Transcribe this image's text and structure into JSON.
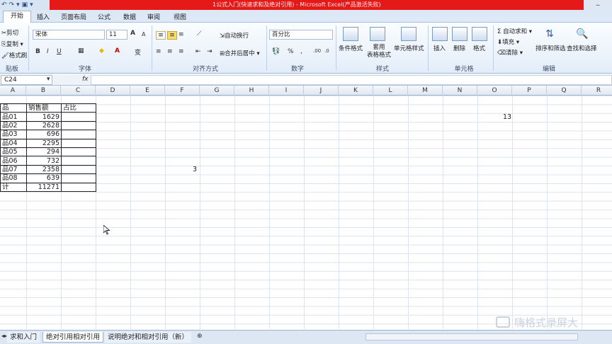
{
  "window": {
    "title": "1公式入门(快速求和及绝对引用) - Microsoft Excel(产品激活失败)"
  },
  "qat": [
    "↶",
    "↷",
    "▾",
    "▣",
    "▾"
  ],
  "tabs": [
    "开始",
    "插入",
    "页面布局",
    "公式",
    "数据",
    "审阅",
    "视图"
  ],
  "ribbon": {
    "clipboard": {
      "cut": "剪切",
      "copy": "复制 ▾",
      "format_painter": "格式刷",
      "label": "贴板"
    },
    "font": {
      "name": "宋体",
      "size": "11",
      "bold": "B",
      "italic": "I",
      "underline": "U",
      "grow": "A",
      "shrink": "A",
      "wen": "变",
      "label": "字体"
    },
    "align": {
      "wrap": "自动换行",
      "merge": "合并后居中 ▾",
      "label": "对齐方式"
    },
    "number": {
      "format": "百分比",
      "pct": "%",
      "comma": ",",
      "label": "数字"
    },
    "styles": {
      "cond": "条件格式",
      "table": "套用\n表格格式",
      "cell": "单元格样式",
      "label": "样式"
    },
    "cells": {
      "insert": "插入",
      "delete": "删除",
      "format": "格式",
      "label": "单元格"
    },
    "edit": {
      "autosum": "Σ 自动求和 ▾",
      "fill": "填充 ▾",
      "clear": "清除 ▾",
      "sort": "排序和筛选",
      "find": "查找和选择",
      "label": "编辑"
    }
  },
  "formula": {
    "namebox": "C24",
    "fx": "fx",
    "content": ""
  },
  "columns": [
    "A",
    "B",
    "C",
    "D",
    "E",
    "F",
    "G",
    "H",
    "I",
    "J",
    "K",
    "L",
    "M",
    "N",
    "O",
    "P",
    "Q",
    "R"
  ],
  "table": {
    "headers": [
      "品",
      "销售额",
      "占比"
    ],
    "rows": [
      [
        "品01",
        "1629",
        ""
      ],
      [
        "品02",
        "2628",
        ""
      ],
      [
        "品03",
        "696",
        ""
      ],
      [
        "品04",
        "2295",
        ""
      ],
      [
        "品05",
        "294",
        ""
      ],
      [
        "品06",
        "732",
        ""
      ],
      [
        "品07",
        "2358",
        ""
      ],
      [
        "品08",
        "639",
        ""
      ],
      [
        "计",
        "11271",
        ""
      ]
    ]
  },
  "extra_cells": {
    "f_value": "3",
    "o_value": "13"
  },
  "sheets": [
    "求和入门",
    "绝对引用相对引用",
    "说明绝对和相对引用（新）"
  ],
  "watermark": "嗨格式录屏大"
}
